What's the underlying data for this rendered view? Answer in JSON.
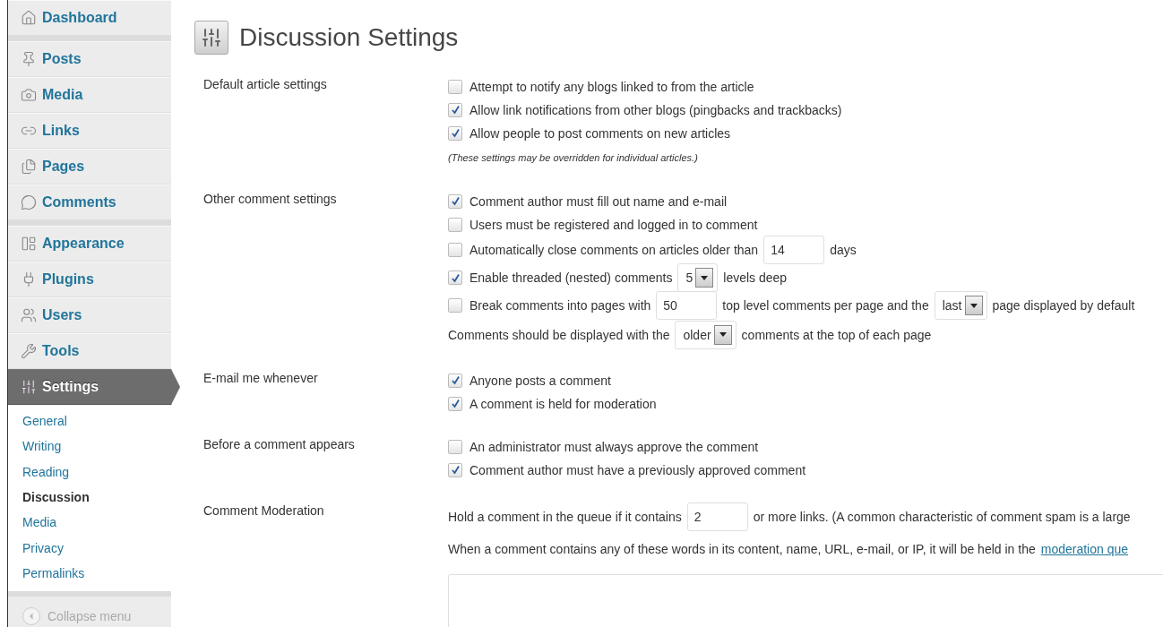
{
  "sidebar": {
    "groups": [
      [
        {
          "label": "Dashboard",
          "selected": false
        }
      ],
      [
        {
          "label": "Posts",
          "selected": false
        },
        {
          "label": "Media",
          "selected": false
        },
        {
          "label": "Links",
          "selected": false
        },
        {
          "label": "Pages",
          "selected": false
        },
        {
          "label": "Comments",
          "selected": false
        }
      ],
      [
        {
          "label": "Appearance",
          "selected": false
        },
        {
          "label": "Plugins",
          "selected": false
        },
        {
          "label": "Users",
          "selected": false
        },
        {
          "label": "Tools",
          "selected": false
        },
        {
          "label": "Settings",
          "selected": true,
          "children": [
            {
              "label": "General",
              "selected": false
            },
            {
              "label": "Writing",
              "selected": false
            },
            {
              "label": "Reading",
              "selected": false
            },
            {
              "label": "Discussion",
              "selected": true
            },
            {
              "label": "Media",
              "selected": false
            },
            {
              "label": "Privacy",
              "selected": false
            },
            {
              "label": "Permalinks",
              "selected": false
            }
          ]
        }
      ]
    ],
    "collapse_label": "Collapse menu"
  },
  "page": {
    "title": "Discussion Settings"
  },
  "sections": [
    {
      "label": "Default article settings",
      "rows": [
        {
          "kind": "checkbox",
          "checked": false,
          "parts": [
            {
              "kind": "text",
              "value": "Attempt to notify any blogs linked to from the article"
            }
          ]
        },
        {
          "kind": "checkbox",
          "checked": true,
          "parts": [
            {
              "kind": "text",
              "value": "Allow link notifications from other blogs (pingbacks and trackbacks)"
            }
          ]
        },
        {
          "kind": "checkbox",
          "checked": true,
          "parts": [
            {
              "kind": "text",
              "value": "Allow people to post comments on new articles"
            }
          ]
        },
        {
          "kind": "note",
          "parts": [
            {
              "kind": "text",
              "value": "(These settings may be overridden for individual articles.)"
            }
          ]
        }
      ]
    },
    {
      "label": "Other comment settings",
      "rows": [
        {
          "kind": "checkbox",
          "checked": true,
          "parts": [
            {
              "kind": "text",
              "value": "Comment author must fill out name and e-mail"
            }
          ]
        },
        {
          "kind": "checkbox",
          "checked": false,
          "parts": [
            {
              "kind": "text",
              "value": "Users must be registered and logged in to comment"
            }
          ]
        },
        {
          "kind": "checkbox",
          "checked": false,
          "parts": [
            {
              "kind": "text",
              "value": "Automatically close comments on articles older than"
            },
            {
              "kind": "input",
              "value": "14"
            },
            {
              "kind": "text",
              "value": "days"
            }
          ]
        },
        {
          "kind": "checkbox",
          "checked": true,
          "parts": [
            {
              "kind": "text",
              "value": "Enable threaded (nested) comments"
            },
            {
              "kind": "select",
              "value": "5"
            },
            {
              "kind": "text",
              "value": "levels deep"
            }
          ]
        },
        {
          "kind": "checkbox",
          "checked": false,
          "parts": [
            {
              "kind": "text",
              "value": "Break comments into pages with"
            },
            {
              "kind": "input",
              "value": "50"
            },
            {
              "kind": "text",
              "value": "top level comments per page and the"
            },
            {
              "kind": "select",
              "value": "last"
            },
            {
              "kind": "text",
              "value": "page displayed by default"
            }
          ]
        },
        {
          "kind": "line",
          "parts": [
            {
              "kind": "text",
              "value": "Comments should be displayed with the"
            },
            {
              "kind": "select",
              "value": "older"
            },
            {
              "kind": "text",
              "value": "comments at the top of each page"
            }
          ]
        }
      ]
    },
    {
      "label": "E-mail me whenever",
      "rows": [
        {
          "kind": "checkbox",
          "checked": true,
          "parts": [
            {
              "kind": "text",
              "value": "Anyone posts a comment"
            }
          ]
        },
        {
          "kind": "checkbox",
          "checked": true,
          "parts": [
            {
              "kind": "text",
              "value": "A comment is held for moderation"
            }
          ]
        }
      ]
    },
    {
      "label": "Before a comment appears",
      "rows": [
        {
          "kind": "checkbox",
          "checked": false,
          "parts": [
            {
              "kind": "text",
              "value": "An administrator must always approve the comment"
            }
          ]
        },
        {
          "kind": "checkbox",
          "checked": true,
          "parts": [
            {
              "kind": "text",
              "value": "Comment author must have a previously approved comment"
            }
          ]
        }
      ]
    },
    {
      "label": "Comment Moderation",
      "rows": [
        {
          "kind": "line",
          "parts": [
            {
              "kind": "text",
              "value": "Hold a comment in the queue if it contains"
            },
            {
              "kind": "input",
              "value": "2"
            },
            {
              "kind": "text",
              "value": "or more links. (A common characteristic of comment spam is a large"
            }
          ]
        },
        {
          "kind": "para",
          "parts": [
            {
              "kind": "text",
              "value": "When a comment contains any of these words in its content, name, URL, e-mail, or IP, it will be held in the"
            },
            {
              "kind": "link",
              "value": "moderation que"
            }
          ]
        },
        {
          "kind": "textarea"
        }
      ]
    }
  ]
}
